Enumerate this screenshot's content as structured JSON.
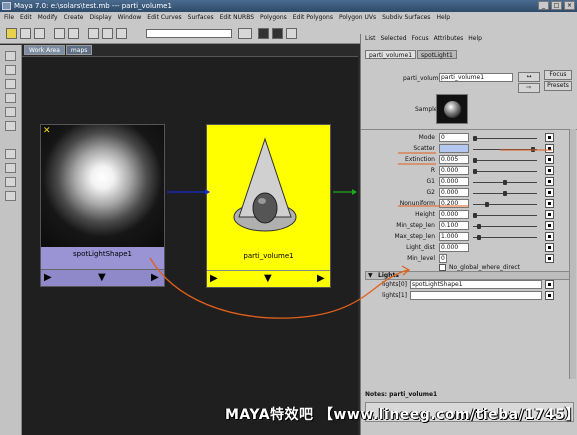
{
  "window": {
    "title": "Maya 7.0: e:\\solars\\test.mb  ---  parti_volume1",
    "controls": [
      "_",
      "□",
      "×"
    ]
  },
  "menubar": {
    "items": [
      "File",
      "Edit",
      "Modify",
      "Create",
      "Display",
      "Window",
      "Edit Curves",
      "Surfaces",
      "Edit NURBS",
      "Polygons",
      "Edit Polygons",
      "Polygon UVs",
      "Subdiv Surfaces",
      "Help"
    ]
  },
  "graph": {
    "tabs": [
      "Work Area",
      "maps"
    ],
    "nodes": {
      "spotlight": {
        "label": "spotLightShape1"
      },
      "volume": {
        "label": "parti_volume1"
      }
    },
    "arrow_glyphs": {
      "left": "▶",
      "down": "▼",
      "right": "▶"
    },
    "connection_colors": {
      "spot_to_volume": "#1a2bd6",
      "volume_out": "#1fa81f",
      "annotation": "#e0601a"
    }
  },
  "attribute_editor": {
    "menu": [
      "List",
      "Selected",
      "Focus",
      "Attributes",
      "Help"
    ],
    "tabs": [
      "parti_volume1",
      "spotLight1"
    ],
    "node_label": "parti_volume:",
    "node_name": "parti_volume1",
    "focus_button": "Focus",
    "presets_button": "Presets",
    "sample_label": "Sample",
    "attributes": [
      {
        "label": "Mode",
        "value": "0"
      },
      {
        "label": "Scatter",
        "value": ""
      },
      {
        "label": "Extinction",
        "value": "0.005"
      },
      {
        "label": "R",
        "value": "0.000"
      },
      {
        "label": "G1",
        "value": "0.000"
      },
      {
        "label": "G2",
        "value": "0.000"
      },
      {
        "label": "Nonuniform",
        "value": "0.200"
      },
      {
        "label": "Height",
        "value": "0.000"
      },
      {
        "label": "Min_step_len",
        "value": "0.100"
      },
      {
        "label": "Max_step_len",
        "value": "1.000"
      },
      {
        "label": "Light_dist",
        "value": "0.000"
      },
      {
        "label": "Min_level",
        "value": "0"
      }
    ],
    "checkbox_label": "No_global_where_direct",
    "lights_section": "Lights",
    "lights": [
      {
        "label": "lights[0]",
        "value": "spotLightShape1"
      },
      {
        "label": "lights[1]",
        "value": ""
      }
    ],
    "notes_label": "Notes: parti_volume1"
  },
  "watermark": "MAYA特效吧 【www.lineeg.com/tieba/1745】"
}
